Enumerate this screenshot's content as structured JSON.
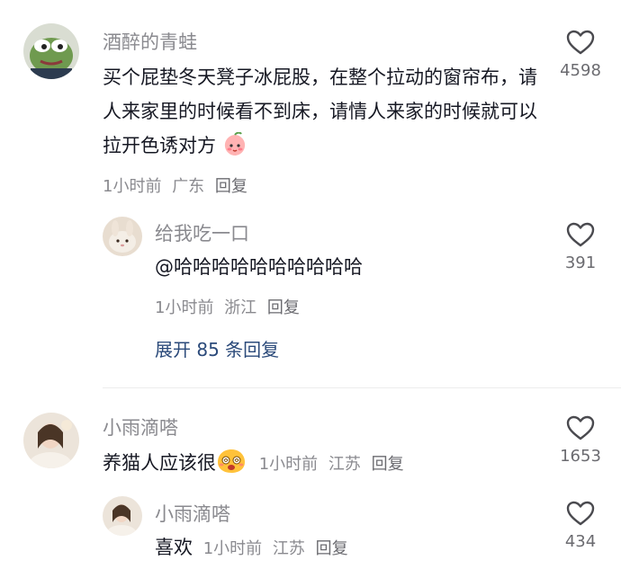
{
  "comments": [
    {
      "username": "酒醉的青蛙",
      "text": "买个屁垫冬天凳子冰屁股，在整个拉动的窗帘布，请人来家里的时候看不到床，请情人来家的时候就可以拉开色诱对方",
      "emoji": "peach-blush-emoji",
      "meta": {
        "time": "1小时前",
        "location": "广东",
        "reply": "回复"
      },
      "likes": "4598",
      "replies": [
        {
          "username": "给我吃一口",
          "text": "@哈哈哈哈哈哈哈哈哈哈",
          "meta": {
            "time": "1小时前",
            "location": "浙江",
            "reply": "回复"
          },
          "likes": "391"
        }
      ],
      "expand_label": "展开 85 条回复"
    },
    {
      "username": "小雨滴嗒",
      "text": "养猫人应该很",
      "emoji": "dizzy-face-emoji",
      "meta": {
        "time": "1小时前",
        "location": "江苏",
        "reply": "回复"
      },
      "likes": "1653",
      "replies": [
        {
          "username": "小雨滴嗒",
          "text": "喜欢",
          "meta": {
            "time": "1小时前",
            "location": "江苏",
            "reply": "回复"
          },
          "likes": "434"
        }
      ]
    }
  ],
  "colors": {
    "text": "#161823",
    "muted": "#8a8a8f",
    "link": "#2b4a7a",
    "divider": "#ececec"
  },
  "icons": {
    "like": "heart-outline-icon"
  }
}
